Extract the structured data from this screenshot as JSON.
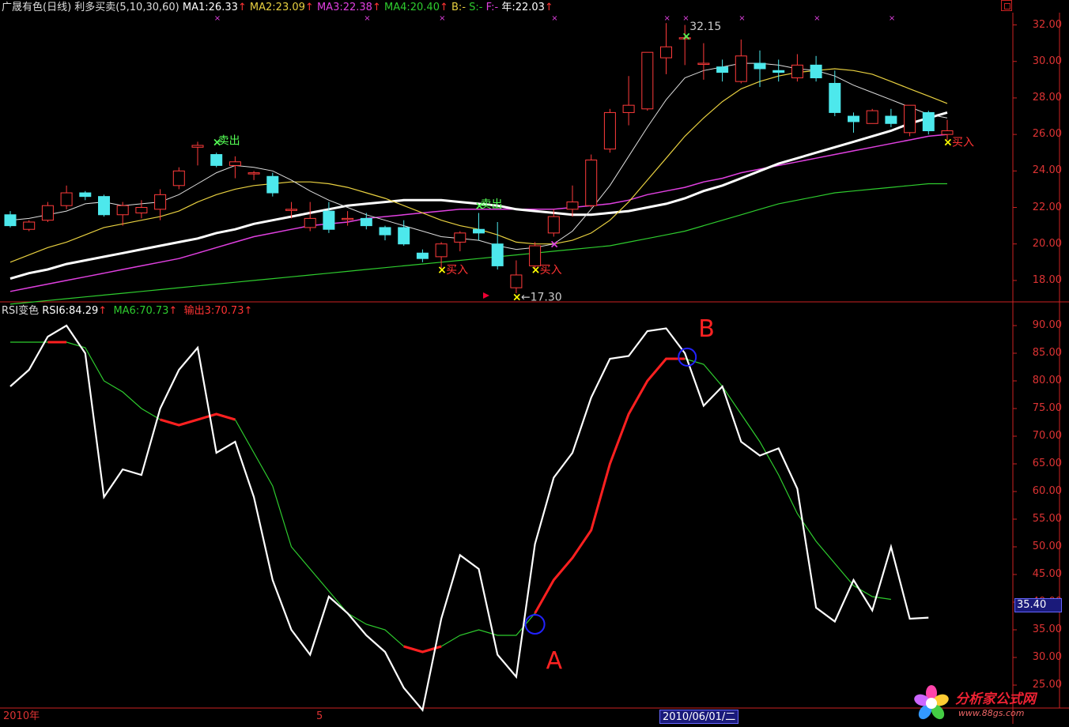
{
  "main_panel": {
    "title": "广晟有色(日线)",
    "indicator": "利多买卖(5,10,30,60)",
    "ma1": "MA1:26.33",
    "ma2": "MA2:23.09",
    "ma3": "MA3:22.38",
    "ma4": "MA4:20.40",
    "b": "B:-",
    "s": "S:-",
    "f": "F:-",
    "year": "年:22.03",
    "arrow": "↑",
    "price_ticks": [
      "32.00",
      "30.00",
      "28.00",
      "26.00",
      "24.00",
      "22.00",
      "20.00",
      "18.00"
    ],
    "annotations": {
      "sell1": "卖出",
      "sell2": "卖出",
      "buy1": "买入",
      "buy2": "买入",
      "buy3": "买入",
      "high": "32.15",
      "low": "17.30"
    }
  },
  "rsi_panel": {
    "title": "RSI变色",
    "rsi6": "RSI6:84.29",
    "ma6": "MA6:70.73",
    "output": "输出3:70.73",
    "arrow": "↑",
    "ticks": [
      "90.00",
      "85.00",
      "80.00",
      "75.00",
      "70.00",
      "65.00",
      "60.00",
      "55.00",
      "50.00",
      "45.00",
      "40.00",
      "35.00",
      "30.00",
      "25.00"
    ],
    "current_value": "35.40",
    "markers": {
      "a": "A",
      "b": "B"
    }
  },
  "date_axis": {
    "start": "2010年",
    "month": "5",
    "cursor_date": "2010/06/01/二"
  },
  "watermark": {
    "name": "分析家公式网",
    "url": "www.88gs.com"
  },
  "colors": {
    "up": "#ff3b3b",
    "down": "#4de8ec",
    "ma1": "#ffffff",
    "ma2": "#e8d040",
    "ma3": "#e040e0",
    "ma4": "#2ecc2e",
    "rsi": "#ffffff",
    "rsi_ma": "#2ecc2e",
    "rsi_hi": "#ff2020"
  },
  "chart_data": {
    "type": "candlestick",
    "price_axis": [
      17,
      32.5
    ],
    "candles": [
      [
        21.6,
        21.0,
        21.8,
        20.9
      ],
      [
        20.8,
        21.2,
        21.3,
        20.7
      ],
      [
        21.3,
        22.1,
        22.3,
        21.2
      ],
      [
        22.1,
        22.8,
        23.2,
        21.9
      ],
      [
        22.8,
        22.6,
        22.9,
        22.4
      ],
      [
        22.6,
        21.6,
        22.7,
        21.5
      ],
      [
        21.6,
        22.1,
        22.3,
        21.0
      ],
      [
        21.7,
        22.0,
        22.4,
        21.4
      ],
      [
        21.9,
        22.7,
        23.0,
        21.3
      ],
      [
        23.2,
        24.0,
        24.2,
        23.0
      ],
      [
        25.3,
        25.4,
        25.6,
        24.3
      ],
      [
        24.9,
        24.3,
        25.0,
        24.2
      ],
      [
        24.3,
        24.5,
        24.8,
        23.6
      ],
      [
        23.9,
        23.9,
        24.0,
        23.5
      ],
      [
        23.7,
        22.8,
        23.9,
        22.6
      ],
      [
        21.9,
        21.9,
        22.3,
        21.4
      ],
      [
        20.9,
        21.4,
        22.3,
        20.7
      ],
      [
        21.8,
        20.8,
        22.3,
        20.6
      ],
      [
        21.4,
        21.4,
        21.8,
        21.0
      ],
      [
        21.4,
        21.0,
        21.7,
        20.8
      ],
      [
        20.9,
        20.5,
        21.0,
        20.2
      ],
      [
        20.9,
        20.0,
        21.3,
        19.9
      ],
      [
        19.5,
        19.2,
        19.7,
        19.0
      ],
      [
        19.3,
        20.0,
        20.1,
        18.6
      ],
      [
        20.1,
        20.6,
        20.7,
        19.6
      ],
      [
        20.8,
        20.6,
        21.7,
        20.2
      ],
      [
        20.0,
        18.8,
        21.2,
        18.6
      ],
      [
        17.6,
        18.3,
        19.1,
        17.3
      ],
      [
        18.8,
        19.9,
        20.1,
        18.6
      ],
      [
        20.6,
        21.5,
        21.9,
        20.4
      ],
      [
        21.9,
        22.3,
        23.2,
        21.5
      ],
      [
        22.1,
        24.6,
        24.9,
        22.0
      ],
      [
        25.2,
        27.2,
        27.4,
        25.0
      ],
      [
        27.2,
        27.6,
        29.2,
        26.5
      ],
      [
        27.4,
        30.5,
        30.5,
        27.3
      ],
      [
        30.2,
        30.8,
        32.1,
        29.3
      ],
      [
        31.3,
        31.3,
        32.0,
        29.8
      ],
      [
        29.9,
        29.9,
        31.0,
        29.0
      ],
      [
        29.7,
        29.4,
        30.1,
        28.9
      ],
      [
        28.9,
        30.3,
        31.2,
        28.8
      ],
      [
        29.9,
        29.6,
        30.6,
        28.6
      ],
      [
        29.5,
        29.4,
        30.1,
        28.9
      ],
      [
        29.1,
        29.8,
        30.4,
        28.9
      ],
      [
        29.8,
        29.1,
        30.3,
        28.9
      ],
      [
        28.8,
        27.2,
        29.5,
        27.0
      ],
      [
        27.0,
        26.7,
        27.2,
        26.1
      ],
      [
        26.6,
        27.3,
        27.4,
        26.6
      ],
      [
        27.0,
        26.6,
        27.4,
        26.4
      ],
      [
        26.1,
        27.6,
        27.6,
        25.9
      ],
      [
        27.2,
        26.2,
        27.3,
        26.0
      ],
      [
        26.0,
        26.2,
        26.8,
        25.7
      ]
    ],
    "ma1": [
      21.3,
      21.4,
      21.6,
      21.8,
      22.2,
      22.3,
      22.1,
      22.2,
      22.3,
      22.7,
      23.3,
      23.9,
      24.3,
      24.2,
      24.0,
      23.5,
      22.9,
      22.4,
      22.0,
      21.6,
      21.3,
      21.0,
      20.7,
      20.4,
      20.3,
      20.2,
      19.9,
      19.7,
      19.8,
      20.0,
      20.7,
      21.9,
      23.2,
      24.8,
      26.4,
      27.9,
      29.1,
      29.5,
      29.7,
      29.9,
      29.9,
      29.8,
      29.6,
      29.5,
      29.2,
      28.7,
      28.3,
      27.9,
      27.5,
      27.1,
      26.9
    ],
    "ma2": [
      19.0,
      19.4,
      19.8,
      20.1,
      20.5,
      20.9,
      21.1,
      21.3,
      21.5,
      21.8,
      22.3,
      22.7,
      23.0,
      23.2,
      23.3,
      23.4,
      23.4,
      23.3,
      23.1,
      22.8,
      22.5,
      22.1,
      21.7,
      21.3,
      21.0,
      20.8,
      20.5,
      20.1,
      20.0,
      20.0,
      20.2,
      20.6,
      21.3,
      22.3,
      23.5,
      24.7,
      25.9,
      26.9,
      27.8,
      28.5,
      28.9,
      29.2,
      29.4,
      29.5,
      29.6,
      29.5,
      29.3,
      28.9,
      28.5,
      28.1,
      27.7
    ],
    "ma3": [
      17.4,
      17.6,
      17.8,
      18.0,
      18.2,
      18.4,
      18.6,
      18.8,
      19.0,
      19.2,
      19.5,
      19.8,
      20.1,
      20.4,
      20.6,
      20.8,
      21.0,
      21.1,
      21.2,
      21.4,
      21.5,
      21.6,
      21.7,
      21.8,
      21.9,
      21.9,
      21.9,
      21.9,
      21.9,
      21.9,
      22.0,
      22.1,
      22.2,
      22.4,
      22.7,
      22.9,
      23.1,
      23.4,
      23.6,
      23.9,
      24.1,
      24.3,
      24.5,
      24.7,
      24.9,
      25.1,
      25.3,
      25.5,
      25.7,
      25.9,
      26.0
    ],
    "ma4": [
      16.7,
      16.8,
      16.9,
      17.0,
      17.1,
      17.2,
      17.3,
      17.4,
      17.5,
      17.6,
      17.7,
      17.8,
      17.9,
      18.0,
      18.1,
      18.2,
      18.3,
      18.4,
      18.5,
      18.6,
      18.7,
      18.8,
      18.9,
      19.0,
      19.1,
      19.2,
      19.3,
      19.4,
      19.5,
      19.6,
      19.7,
      19.8,
      19.9,
      20.1,
      20.3,
      20.5,
      20.7,
      21.0,
      21.3,
      21.6,
      21.9,
      22.2,
      22.4,
      22.6,
      22.8,
      22.9,
      23.0,
      23.1,
      23.2,
      23.3,
      23.3
    ],
    "ma_thick": [
      18.1,
      18.4,
      18.6,
      18.9,
      19.1,
      19.3,
      19.5,
      19.7,
      19.9,
      20.1,
      20.3,
      20.6,
      20.8,
      21.1,
      21.3,
      21.5,
      21.7,
      21.9,
      22.1,
      22.2,
      22.3,
      22.4,
      22.4,
      22.4,
      22.3,
      22.2,
      22.1,
      21.9,
      21.8,
      21.7,
      21.6,
      21.6,
      21.7,
      21.8,
      22.0,
      22.2,
      22.5,
      22.9,
      23.2,
      23.6,
      24.0,
      24.4,
      24.7,
      25.0,
      25.3,
      25.6,
      25.9,
      26.2,
      26.6,
      26.9,
      27.2
    ],
    "rsi_axis": [
      22,
      92
    ],
    "rsi": [
      79,
      82,
      88,
      90,
      85,
      59,
      64,
      63,
      75,
      82,
      86,
      67,
      69,
      59,
      44,
      35,
      30.5,
      41,
      38,
      34,
      31,
      24.5,
      20.5,
      37,
      48.5,
      46,
      30.5,
      26.5,
      50.5,
      62.5,
      67,
      77,
      84,
      84.5,
      89,
      89.5,
      85,
      75.5,
      79,
      69,
      66.5,
      67.8,
      60.5,
      39,
      36.5,
      44,
      38.5,
      50,
      37,
      37.2
    ],
    "rsi_ma": [
      87,
      87,
      87,
      87,
      86,
      80,
      78,
      75,
      73,
      72,
      73,
      74,
      73,
      67,
      61,
      50,
      46,
      42,
      38,
      36,
      35,
      32,
      31,
      32,
      34,
      35,
      34,
      34,
      38,
      44,
      48,
      53,
      65,
      74,
      80,
      84,
      84,
      83,
      79,
      74,
      69,
      63,
      56,
      51,
      47,
      43,
      41,
      40.5
    ]
  }
}
